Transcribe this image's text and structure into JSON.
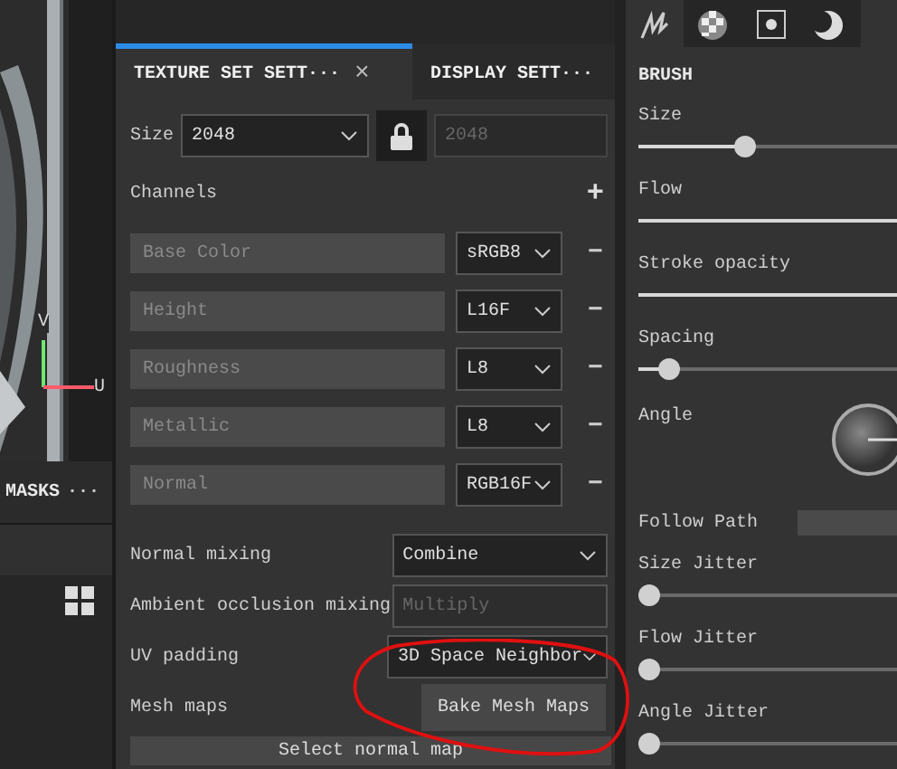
{
  "viewport": {
    "kind": "picture",
    "axis_labels": [
      "V",
      "U"
    ]
  },
  "masks_tab": {
    "label": "MASKS",
    "more": "···"
  },
  "tabs": [
    {
      "label": "TEXTURE SET SETT···",
      "selected": true,
      "close": "×"
    },
    {
      "label": "DISPLAY SETT···",
      "selected": false
    }
  ],
  "size": {
    "label": "Size",
    "value": "2048",
    "locked": true,
    "second_value": "2048"
  },
  "channels": {
    "label": "Channels",
    "add": "+",
    "items": [
      {
        "name": "Base Color",
        "format": "sRGB8",
        "remove": "−"
      },
      {
        "name": "Height",
        "format": "L16F",
        "remove": "−"
      },
      {
        "name": "Roughness",
        "format": "L8",
        "remove": "−"
      },
      {
        "name": "Metallic",
        "format": "L8",
        "remove": "−"
      },
      {
        "name": "Normal",
        "format": "RGB16F",
        "remove": "−"
      }
    ]
  },
  "settings": [
    {
      "label": "Normal mixing",
      "value": "Combine",
      "disabled": false
    },
    {
      "label": "Ambient occlusion mixing",
      "value": "Multiply",
      "disabled": true
    },
    {
      "label": "UV padding",
      "value": "3D Space Neighbor",
      "disabled": false
    }
  ],
  "mesh_maps": {
    "label": "Mesh maps",
    "button": "Bake Mesh Maps",
    "select": "Select normal map"
  },
  "brush": {
    "title": "BRUSH",
    "params": [
      {
        "kind": "slider",
        "label": "Size",
        "level": 0.38
      },
      {
        "kind": "slider",
        "label": "Flow",
        "level": 1
      },
      {
        "kind": "slider",
        "label": "Stroke opacity",
        "level": 1
      },
      {
        "kind": "slider",
        "label": "Spacing",
        "level": 0.08
      },
      {
        "kind": "dial",
        "label": "Angle"
      },
      {
        "kind": "toggle",
        "label": "Follow Path"
      },
      {
        "kind": "slider",
        "label": "Size Jitter",
        "level": 0
      },
      {
        "kind": "slider",
        "label": "Flow Jitter",
        "level": 0
      },
      {
        "kind": "slider",
        "label": "Angle Jitter",
        "level": 0
      }
    ]
  },
  "brush_tabs": [
    {
      "selected": true
    },
    {
      "selected": false
    },
    {
      "selected": false
    },
    {
      "selected": false
    }
  ]
}
